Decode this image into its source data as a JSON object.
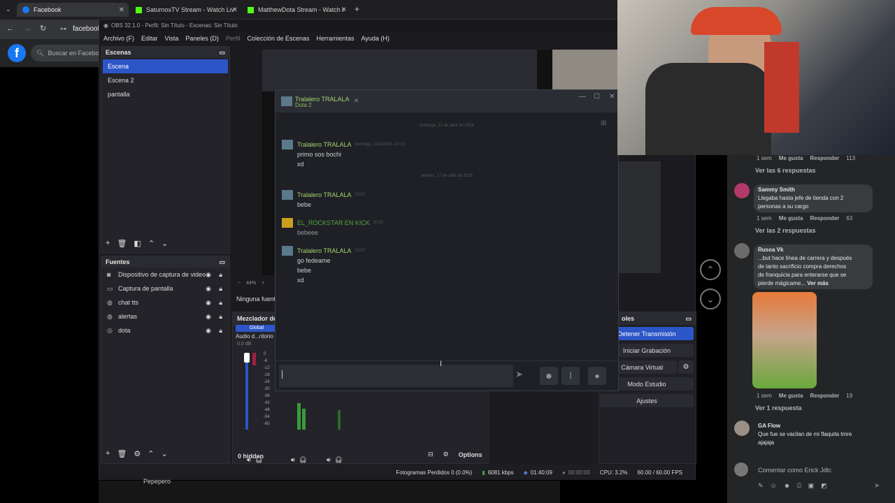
{
  "browser": {
    "tabs": [
      {
        "label": "Facebook"
      },
      {
        "label": "SaturnoxTV Stream - Watch Liv"
      },
      {
        "label": "MatthewDota Stream - Watch I"
      }
    ],
    "url_text": "facebook",
    "fb_search_placeholder": "Buscar en Facebook"
  },
  "obs": {
    "title": "OBS 32.1.0 - Perfil: Sin Título - Escenas: Sin Título",
    "menu": [
      "Archivo (F)",
      "Editar",
      "Vista",
      "Paneles (D)",
      "Perfil",
      "Colección de Escenas",
      "Herramientas",
      "Ayuda (H)"
    ],
    "scenes_title": "Escenas",
    "scenes": [
      "Escena",
      "Escena 2",
      "pantalla"
    ],
    "sources_title": "Fuentes",
    "sources": [
      {
        "label": "Dispositivo de captura de video",
        "icon": "camera-icon"
      },
      {
        "label": "Captura de pantalla",
        "icon": "monitor-icon"
      },
      {
        "label": "chat tts",
        "icon": "globe-icon"
      },
      {
        "label": "alertas",
        "icon": "globe-icon"
      },
      {
        "label": "dota",
        "icon": "gamepad-icon"
      }
    ],
    "zoom": "44%",
    "no_source": "Ninguna fuent",
    "mixer_title": "Mezclador de",
    "mixer_global": "Global",
    "mixer_channel": "Audio d...ritorio",
    "mixer_db": "0.0 dB",
    "mixer_ticks": [
      "0",
      "-6",
      "-12",
      "-18",
      "-24",
      "-30",
      "-36",
      "-42",
      "-48",
      "-54",
      "-60"
    ],
    "controls_title": "oles",
    "controls": [
      "Detener Transmisión",
      "Iniciar Grabación",
      "ar Cámara Virtual",
      "Modo Estudio",
      "Ajustes"
    ],
    "hidden": "0 hidden",
    "options": "Options",
    "status": {
      "frames": "Fotogramas Perdidos 0 (0.0%)",
      "bitrate": "6081 kbps",
      "stream_time": "01:40:09",
      "rec_time": "00:00:00",
      "cpu": "CPU: 3.2%",
      "fps": "60.00 / 60.00 FPS"
    }
  },
  "chat": {
    "title": "Tralalero TRALALA",
    "subtitle": "Dota 2",
    "date1": "domingo, 12 de abril de 2026",
    "date2": "viernes, 17 de abril de 2026",
    "messages": [
      {
        "name": "Tralalero TRALALA",
        "time": "domingo, 12/4/2026, 14:33",
        "lines": [
          "primo sos bochi",
          "xd"
        ]
      },
      {
        "name": "Tralalero TRALALA",
        "time": "20:57",
        "lines": [
          "bebe"
        ]
      },
      {
        "name": "EL_ROCKSTAR EN KICK",
        "time": "20:57",
        "lines": [
          "bebeee"
        ]
      },
      {
        "name": "Tralalero TRALALA",
        "time": "20:57",
        "lines": [
          "go fedeame",
          "bebe",
          "xd"
        ]
      }
    ]
  },
  "facebook": {
    "c0_meta": {
      "time": "1 sem",
      "like": "Me gusta",
      "reply": "Responder",
      "count": "113"
    },
    "c0_replies": "Ver las 6 respuestas",
    "c1": {
      "name": "Sammy Smith",
      "text1": "Llegaba hasta jefe de tienda con 2",
      "text2": "personas a su cargo",
      "time": "1 sem",
      "like": "Me gusta",
      "reply": "Responder",
      "count": "63",
      "replies": "Ver las 2 respuestas"
    },
    "c2": {
      "name": "Rusoa Vk",
      "text1": "...but hace línea de carrera y después",
      "text2": "de tanto sacrificio compra derechos",
      "text3": "de franquicia para enterarse que se",
      "text4": "pierde mágicame...",
      "more": "Ver más",
      "time": "1 sem",
      "like": "Me gusta",
      "reply": "Responder",
      "count": "19",
      "replies": "Ver 1 respuesta"
    },
    "c3": {
      "name": "GA Flow",
      "text1": "Que fue se vacilan de mi flaquita tmre",
      "text2": "ajajaja"
    },
    "comment_placeholder": "Comentar como Erick Jdlc"
  },
  "bottom_text": "Pepepero"
}
